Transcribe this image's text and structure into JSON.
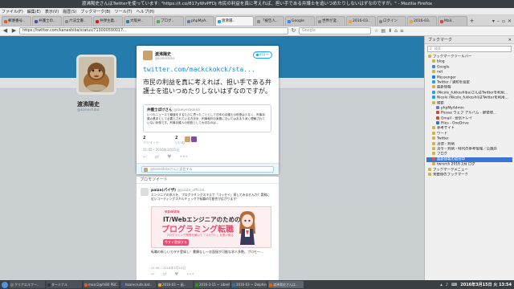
{
  "window": {
    "title": "渡沸陽史さんはTwitterを使っています: \"https://t.co/817yWvPFDj 市民の利益を真に考えれば、担い手である弁護士を追いつめたりしないはずなのですが。\" - Mozilla Firefox"
  },
  "menu": [
    "ファイル(F)",
    "編集(E)",
    "表示(V)",
    "履歴(S)",
    "ブックマーク(B)",
    "ツール(T)",
    "ヘルプ(H)"
  ],
  "tabs": [
    {
      "label": "郵便番号..",
      "icon_color": "#e05a2b",
      "active": false
    },
    {
      "label": "弁護士の..",
      "icon_color": "#3b5998",
      "active": false
    },
    {
      "label": "六法全書..",
      "icon_color": "#888888",
      "active": false
    },
    {
      "label": "弁弾主義..",
      "icon_color": "#cc2222",
      "active": false
    },
    {
      "label": "大阪弁..",
      "icon_color": "#2a7ab8",
      "active": false
    },
    {
      "label": "ブログ..",
      "icon_color": "#55aa55",
      "active": false
    },
    {
      "label": "phpMyA..",
      "icon_color": "#6c78af",
      "active": false
    },
    {
      "label": "渡沸陽..",
      "icon_color": "#1da1f2",
      "active": true
    },
    {
      "label": "「被告人..",
      "icon_color": "#888888",
      "active": false
    },
    {
      "label": "Google",
      "icon_color": "#4285f4",
      "active": false
    },
    {
      "label": "世界が変..",
      "icon_color": "#888888",
      "active": false
    },
    {
      "label": "2016-03..",
      "icon_color": "#e8a23a",
      "active": false
    },
    {
      "label": "ログイン",
      "icon_color": "#888888",
      "active": false
    },
    {
      "label": "2016-03..",
      "icon_color": "#e8a23a",
      "active": false
    },
    {
      "label": "Mail..",
      "icon_color": "#d44638",
      "active": false
    }
  ],
  "nav": {
    "url": "https://twitter.com/kaneshiba/status/713000590017...",
    "search_placeholder": "Google"
  },
  "profile": {
    "name": "渡沸陽史",
    "handle": "@kaneshiba"
  },
  "tweet": {
    "name": "渡沸陽史",
    "handle": "@kaneshiba",
    "follow_label": "フォロー",
    "url": "twitter.com/mackckokck/sta...",
    "text": "市民の利益を真に考えれば、担い手である弁護士を追いつめたりしないはずなのですが。",
    "quote_name": "弁護士ぼけさん",
    "quote_handle": "@lawyerbokeh",
    "quote_text": "いつもニュースで報道をするたびに思ったこととして日本の弁護士の役割は少なく、刑事弁護の基本として必要とされている方法を、刑事裁判の実務においてはあまり深く理解されていない状態です。刑事弁護人の役割として大切なのは…",
    "retweets_label": "リツイート",
    "retweets": "2",
    "likes_label": "いいね",
    "likes": "2",
    "date": "11:05 - 2016年3月15日",
    "reply_placeholder": "@kaneshibaさんに返信する"
  },
  "promoted": {
    "heading": "プロモツイート",
    "name": "paiza(パイザ)",
    "handle": "@paiza_official",
    "text": "エンジニアの求人を、プログラミングスキルで「コッセイ」探してみませんか？実務に近いコーディングスキルチェックで転職の可能性が広がります！",
    "ad_brand": "epaiza",
    "ad_line1": "IT/Webエンジニアのための",
    "ad_line2": "プログラミング転職",
    "ad_sub": "プログラミング問題を解いて「スカウト」を受け取る",
    "ad_button": "今すぐ登録する",
    "caption": "転職の新しいカタチ登録し！書類なし一次面接が可能な求人多数。プロモー...",
    "date": "21:40 - 2016年3月10日"
  },
  "sidebar": {
    "title": "ブックマーク",
    "search_placeholder": "検索",
    "items": [
      {
        "label": "ブックマークツールバー",
        "indent": 0,
        "color": "#d4b24c"
      },
      {
        "label": "blog",
        "indent": 1,
        "color": "#d4b24c"
      },
      {
        "label": "Google",
        "indent": 1,
        "color": "#4285f4"
      },
      {
        "label": "net",
        "indent": 1,
        "color": "#d4b24c"
      },
      {
        "label": "Messenger",
        "indent": 1,
        "color": "#0084ff"
      },
      {
        "label": "Twitter / 通知を設定",
        "indent": 1,
        "color": "#1da1f2"
      },
      {
        "label": "最新情報",
        "indent": 1,
        "color": "#d4b24c"
      },
      {
        "label": "(Nicole_fukkoshiba)さんはTwitterを利用...",
        "indent": 1,
        "color": "#1da1f2"
      },
      {
        "label": "Nicole (Nicole_fukkoshi)はTwitterを利用...",
        "indent": 1,
        "color": "#1da1f2"
      },
      {
        "label": "検索",
        "indent": 1,
        "color": "#d4b24c"
      },
      {
        "label": "phpMyAdmin",
        "indent": 2,
        "color": "#6c78af"
      },
      {
        "label": "Picasa ウェブ アルバム - 鍵管理...",
        "indent": 2,
        "color": "#d44638"
      },
      {
        "label": "Gmail - 受信トレイ",
        "indent": 2,
        "color": "#d44638"
      },
      {
        "label": "Files - OneDrive",
        "indent": 2,
        "color": "#2a7ab8"
      },
      {
        "label": "参考サイト",
        "indent": 1,
        "color": "#d4b24c"
      },
      {
        "label": "ワード",
        "indent": 1,
        "color": "#d4b24c"
      },
      {
        "label": "Twitter",
        "indent": 1,
        "color": "#d4b24c"
      },
      {
        "label": "法律・判例",
        "indent": 1,
        "color": "#d4b24c"
      },
      {
        "label": "法令・判例・時代の参考情報／公選弁",
        "indent": 1,
        "color": "#d4b24c"
      },
      {
        "label": "ブログ",
        "indent": 1,
        "color": "#d4b24c"
      },
      {
        "label": "最新情報の取得中",
        "indent": 1,
        "color": "#e05a2b",
        "selected": true
      },
      {
        "label": "twrsrch 2016 2月 ログ",
        "indent": 1,
        "color": "#d4b24c"
      },
      {
        "label": "ブックマークメニュー",
        "indent": 0,
        "color": "#d4b24c"
      },
      {
        "label": "未整理のブックマーク",
        "indent": 0,
        "color": "#d4b24c"
      }
    ]
  },
  "taskbar": {
    "tasks": [
      {
        "label": "クリアエルフー..",
        "icon_color": "#777777"
      },
      {
        "label": "ターミナル",
        "icon_color": "#333333"
      },
      {
        "label": "mozc2@fnB0 PBC..",
        "icon_color": "#e05a2b"
      },
      {
        "label": "hoarecruits.bat..",
        "icon_color": "#3b5998"
      },
      {
        "label": "2016-03 ~ 画..",
        "icon_color": "#e8a23a"
      },
      {
        "label": "2016-3-15 ~ LibrePo..",
        "icon_color": "#18a303"
      },
      {
        "label": "2016-03 ~ Dolphin",
        "icon_color": "#2a7ab8"
      },
      {
        "label": "渡沸陽史さんは..",
        "icon_color": "#e66000",
        "active": true
      }
    ],
    "clock": "2016年3月15日 火 13:54"
  }
}
